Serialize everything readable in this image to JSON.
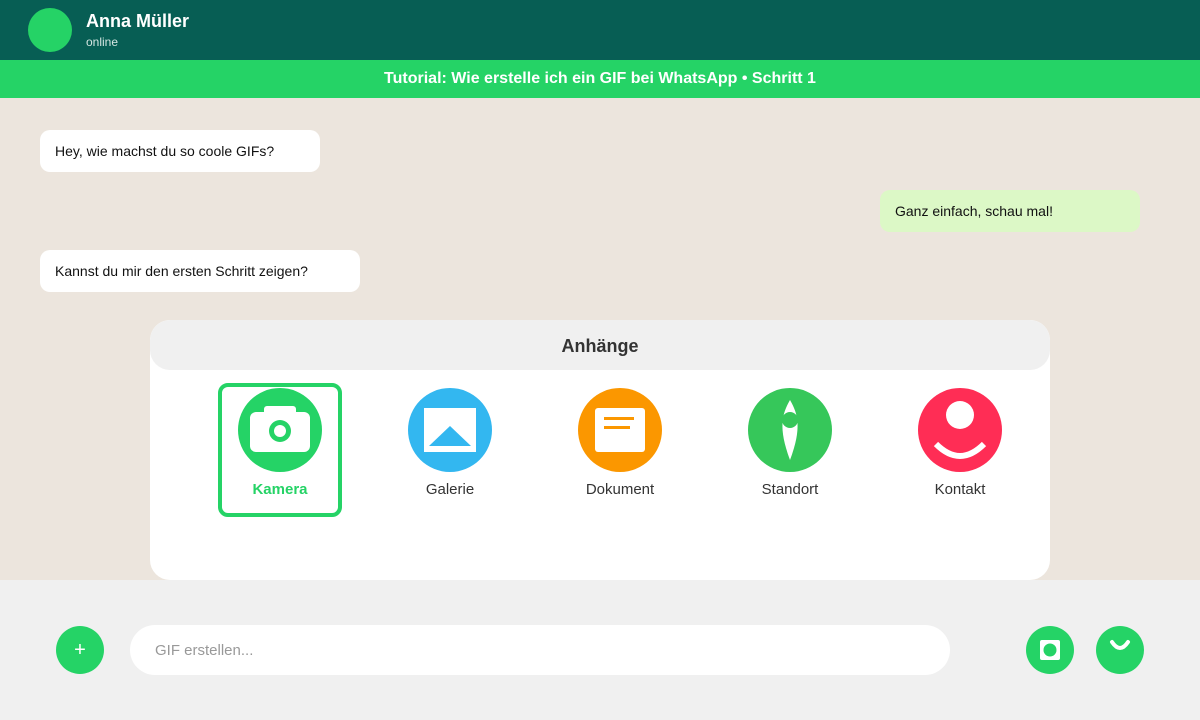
{
  "header": {
    "contact_name": "Anna Müller",
    "status": "online"
  },
  "banner": {
    "text": "Tutorial: Wie erstelle ich ein GIF bei WhatsApp • Schritt 1"
  },
  "messages": [
    {
      "direction": "in",
      "text": "Hey, wie machst du so coole GIFs?"
    },
    {
      "direction": "out",
      "text": "Ganz einfach, schau mal!"
    },
    {
      "direction": "in",
      "text": "Kannst du mir den ersten Schritt zeigen?"
    }
  ],
  "attachments": {
    "title": "Anhänge",
    "options": [
      {
        "label": "Kamera",
        "icon": "camera-icon",
        "color": "#25d366",
        "selected": true
      },
      {
        "label": "Galerie",
        "icon": "gallery-icon",
        "color": "#33b7f0",
        "selected": false
      },
      {
        "label": "Dokument",
        "icon": "document-icon",
        "color": "#fb9700",
        "selected": false
      },
      {
        "label": "Standort",
        "icon": "location-icon",
        "color": "#36c75a",
        "selected": false
      },
      {
        "label": "Kontakt",
        "icon": "contact-icon",
        "color": "#ff2d55",
        "selected": false
      }
    ]
  },
  "footer": {
    "plus_label": "+",
    "input_placeholder": "GIF erstellen...",
    "input_value": ""
  },
  "colors": {
    "header": "#075e54",
    "accent": "#25d366",
    "chat_bg": "#ece5dd",
    "outgoing_bubble": "#dcf8c6",
    "incoming_bubble": "#ffffff"
  }
}
